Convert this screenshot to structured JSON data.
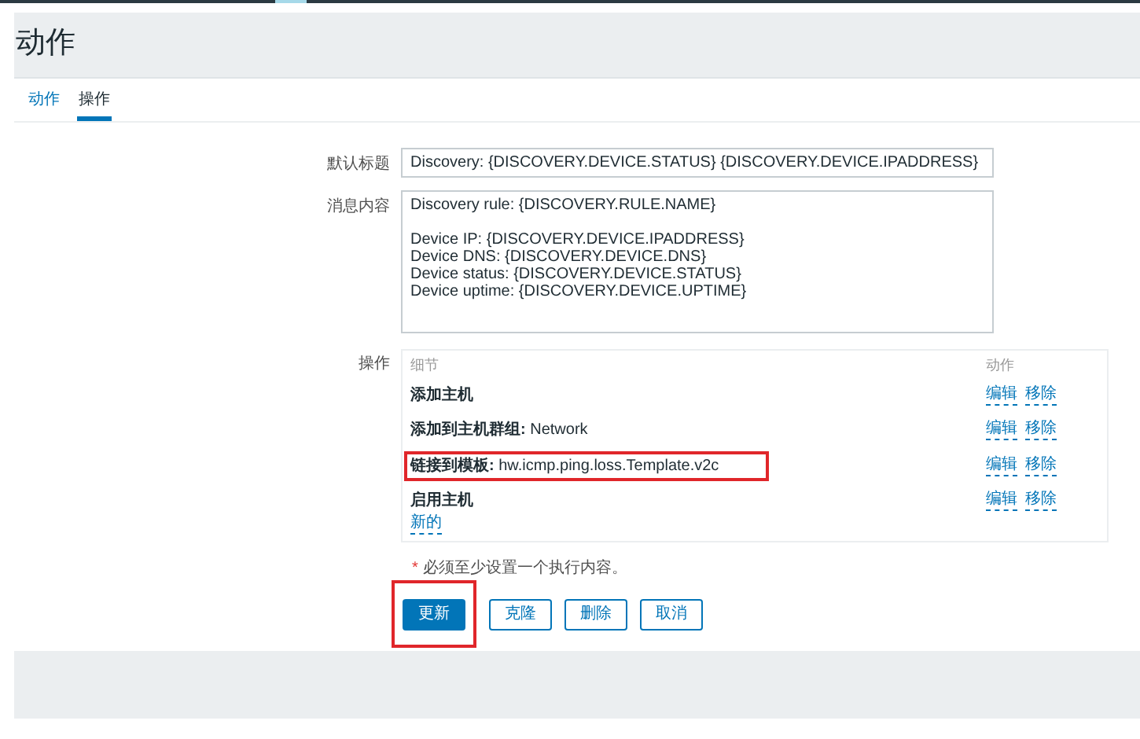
{
  "page_title": "动作",
  "tabs": [
    {
      "label": "动作",
      "selected": false
    },
    {
      "label": "操作",
      "selected": true
    }
  ],
  "fields": [
    {
      "label": "默认标题",
      "kind": "input",
      "value": "Discovery: {DISCOVERY.DEVICE.STATUS} {DISCOVERY.DEVICE.IPADDRESS}"
    },
    {
      "label": "消息内容",
      "kind": "textarea",
      "value": "Discovery rule: {DISCOVERY.RULE.NAME}\n\nDevice IP: {DISCOVERY.DEVICE.IPADDRESS}\nDevice DNS: {DISCOVERY.DEVICE.DNS}\nDevice status: {DISCOVERY.DEVICE.STATUS}\nDevice uptime: {DISCOVERY.DEVICE.UPTIME}"
    }
  ],
  "operations": {
    "label": "操作",
    "columns": [
      "细节",
      "动作"
    ],
    "rows": [
      {
        "name": "添加主机",
        "highlighted": false,
        "actions": [
          "编辑",
          "移除"
        ]
      },
      {
        "name": "添加到主机群组:",
        "value": "Network",
        "highlighted": false,
        "actions": [
          "编辑",
          "移除"
        ]
      },
      {
        "name": "链接到模板:",
        "value": "hw.icmp.ping.loss.Template.v2c",
        "highlighted": true,
        "actions": [
          "编辑",
          "移除"
        ]
      },
      {
        "name": "启用主机",
        "highlighted": false,
        "actions": [
          "编辑",
          "移除"
        ]
      }
    ],
    "new_link": "新的"
  },
  "required_note": {
    "mark": "*",
    "text": "必须至少设置一个执行内容。"
  },
  "buttons": [
    {
      "label": "更新",
      "kind": "primary",
      "highlighted": true
    },
    {
      "label": "克隆",
      "kind": "secondary",
      "highlighted": false
    },
    {
      "label": "删除",
      "kind": "secondary",
      "highlighted": false
    },
    {
      "label": "取消",
      "kind": "secondary",
      "highlighted": false
    }
  ]
}
